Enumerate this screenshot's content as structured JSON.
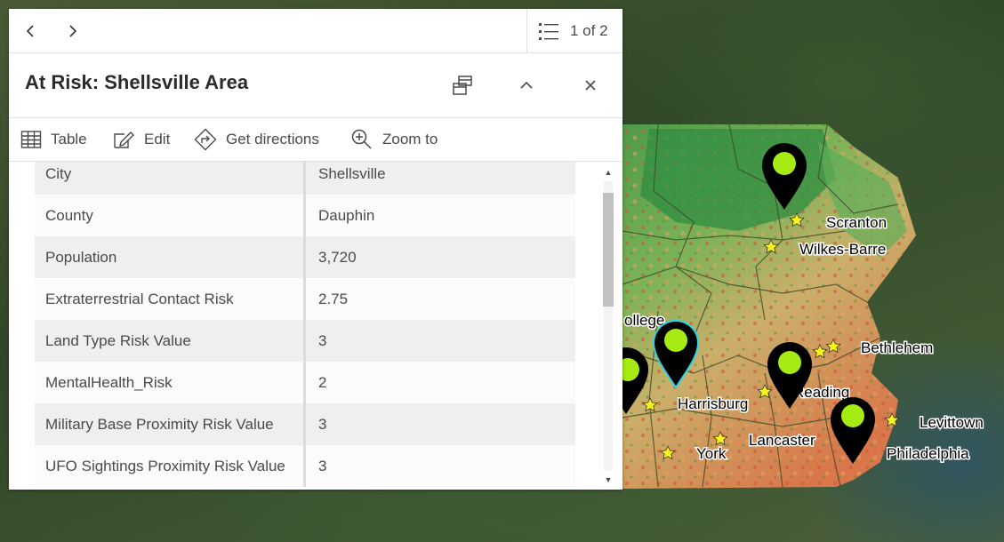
{
  "popup": {
    "pager_text": "1 of 2",
    "title": "At Risk: Shellsville Area",
    "toolbar": {
      "table": "Table",
      "edit": "Edit",
      "directions": "Get directions",
      "zoom": "Zoom to"
    },
    "fields": [
      {
        "label": "City",
        "value": "Shellsville"
      },
      {
        "label": "County",
        "value": "Dauphin"
      },
      {
        "label": "Population",
        "value": "3,720"
      },
      {
        "label": "Extraterrestrial Contact Risk",
        "value": "2.75"
      },
      {
        "label": "Land Type Risk Value",
        "value": "3"
      },
      {
        "label": "MentalHealth_Risk",
        "value": "2"
      },
      {
        "label": "Military Base Proximity Risk Value",
        "value": "3"
      },
      {
        "label": "UFO Sightings Proximity Risk Value",
        "value": "3"
      }
    ]
  },
  "map": {
    "cities": {
      "scranton": "Scranton",
      "wilkes_barre": "Wilkes-Barre",
      "bethlehem": "Bethlehem",
      "reading": "Reading",
      "levittown": "Levittown",
      "harrisburg": "Harrisburg",
      "lancaster": "Lancaster",
      "philadelphia": "Philadelphia",
      "york": "York",
      "state_college_partial": "ollege"
    },
    "colors": {
      "marker": "#000000",
      "marker_dot": "#a6ec14",
      "selected_outline": "#27d6e8",
      "star": "#f7f21e"
    }
  }
}
